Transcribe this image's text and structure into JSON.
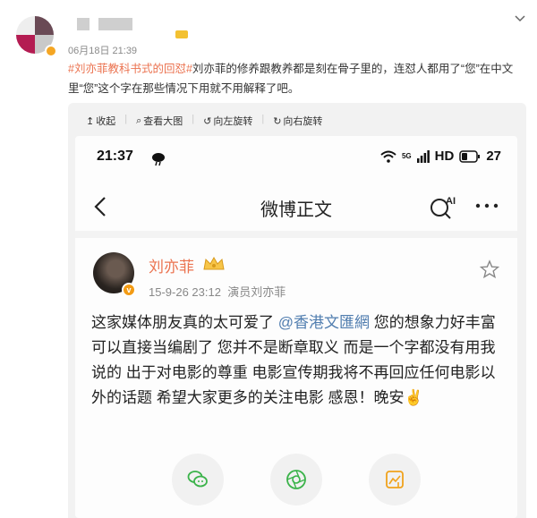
{
  "post": {
    "time": "06月18日 21:39",
    "topic": "#刘亦菲教科书式的回怼#",
    "text": "刘亦菲的修养跟教养都是刻在骨子里的，连怼人都用了“您”在中文里“您”这个字在那些情况下用就不用解释了吧。"
  },
  "viewer": {
    "tools": [
      {
        "icon": "↥",
        "label": "收起"
      },
      {
        "icon": "⌕",
        "label": "查看大图"
      },
      {
        "icon": "↺",
        "label": "向左旋转"
      },
      {
        "icon": "↻",
        "label": "向右旋转"
      }
    ]
  },
  "phone": {
    "status": {
      "time": "21:37",
      "network": "5G",
      "hd": "HD",
      "battery": "27"
    },
    "nav_title": "微博正文",
    "ai_label": "AI",
    "card": {
      "name": "刘亦菲",
      "date": "15-9-26 23:12",
      "source": "演员刘亦菲",
      "text_before": "这家媒体朋友真的太可爱了 ",
      "mention": "@香港文匯網",
      "text_after": " 您的想象力好丰富可以直接当编剧了 您并不是断章取义 而是一个字都没有用我说的 出于对电影的尊重 电影宣传期我将不再回应任何电影以外的话题 希望大家更多的关注电影 感恩！晚安✌️"
    }
  },
  "colors": {
    "topic": "#eb7350",
    "mention": "#507daf",
    "name": "#eb7350",
    "verify": "#f39b14"
  }
}
